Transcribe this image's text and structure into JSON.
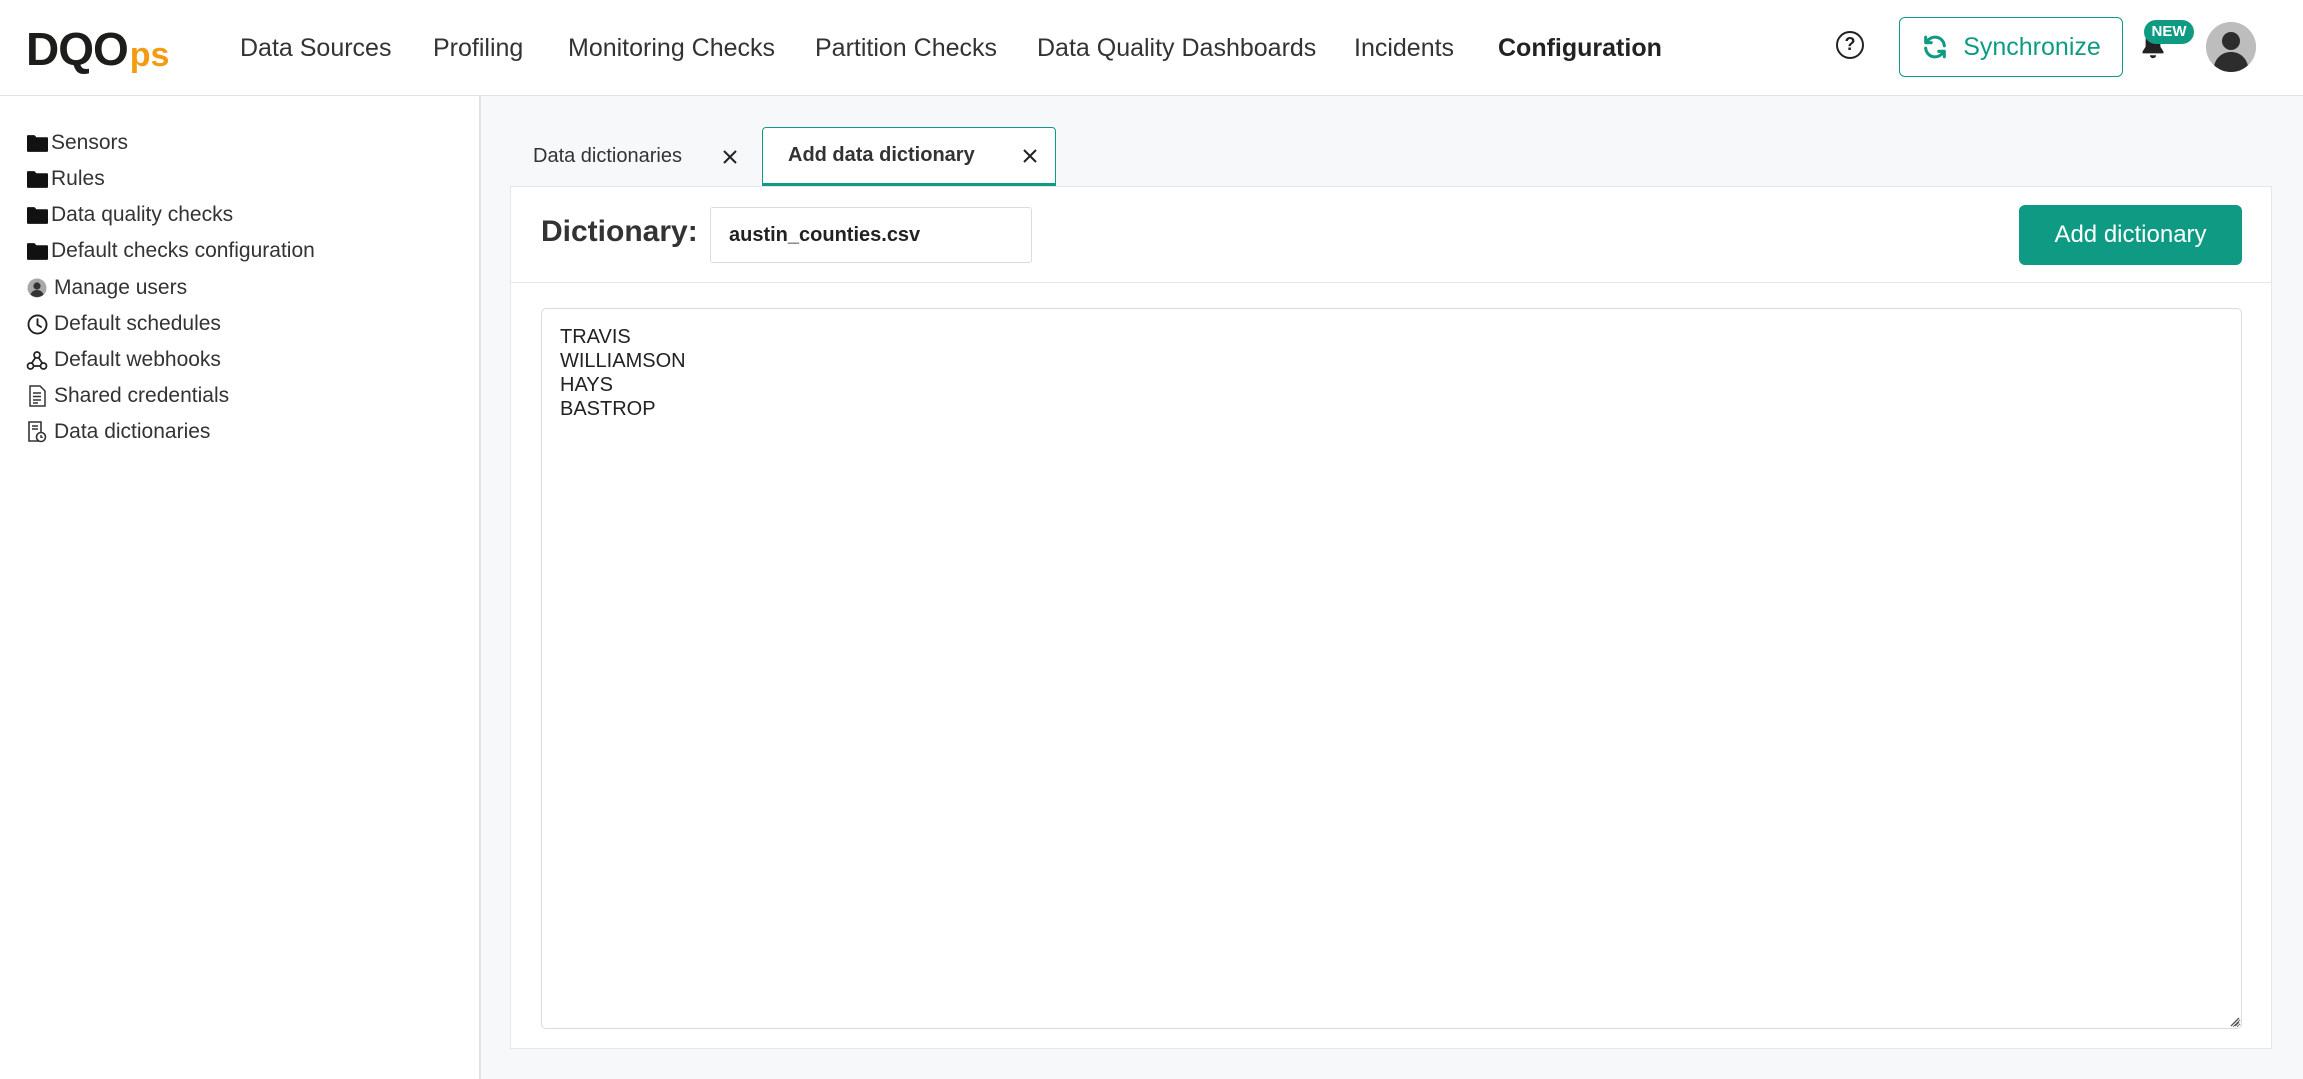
{
  "brand": {
    "logo_main": "DQO",
    "logo_suffix": "ps"
  },
  "nav": {
    "items": [
      "Data Sources",
      "Profiling",
      "Monitoring Checks",
      "Partition Checks",
      "Data Quality Dashboards",
      "Incidents",
      "Configuration"
    ],
    "active": "Configuration"
  },
  "header": {
    "help_icon": "?",
    "sync_label": "Synchronize",
    "new_badge": "NEW"
  },
  "sidebar": {
    "items": [
      {
        "label": "Sensors",
        "icon": "folder-icon"
      },
      {
        "label": "Rules",
        "icon": "folder-icon"
      },
      {
        "label": "Data quality checks",
        "icon": "folder-icon"
      },
      {
        "label": "Default checks configuration",
        "icon": "folder-icon"
      },
      {
        "label": "Manage users",
        "icon": "user-circle-icon"
      },
      {
        "label": "Default schedules",
        "icon": "clock-icon"
      },
      {
        "label": "Default webhooks",
        "icon": "webhook-icon"
      },
      {
        "label": "Shared credentials",
        "icon": "document-icon"
      },
      {
        "label": "Data dictionaries",
        "icon": "dictionary-icon"
      }
    ]
  },
  "tabs": [
    {
      "label": "Data dictionaries",
      "active": false
    },
    {
      "label": "Add data dictionary",
      "active": true
    }
  ],
  "editor": {
    "dictionary_label": "Dictionary:",
    "dictionary_name": "austin_counties.csv",
    "add_button": "Add dictionary",
    "content": "TRAVIS\nWILLIAMSON\nHAYS\nBASTROP"
  },
  "colors": {
    "accent": "#0f9b83",
    "logo_orange": "#f39c12"
  }
}
